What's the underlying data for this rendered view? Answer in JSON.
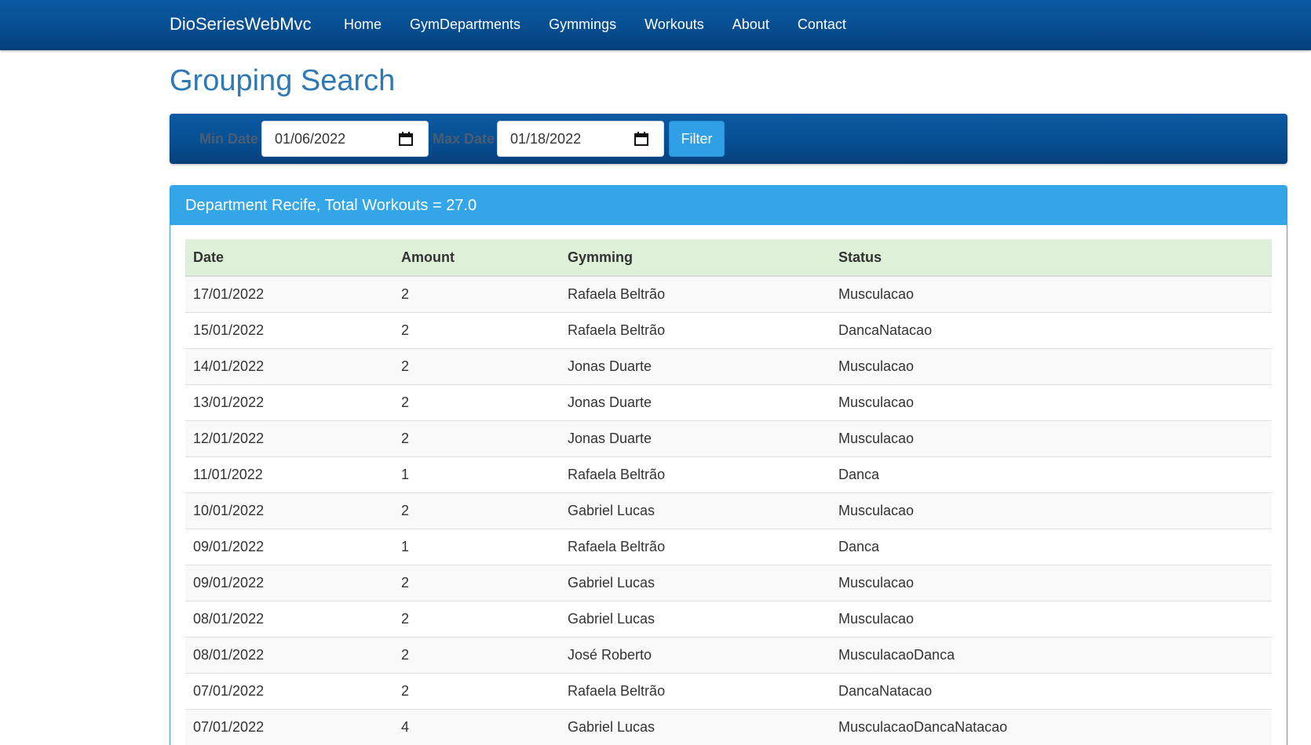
{
  "nav": {
    "brand": "DioSeriesWebMvc",
    "links": [
      "Home",
      "GymDepartments",
      "Gymmings",
      "Workouts",
      "About",
      "Contact"
    ]
  },
  "page": {
    "title": "Grouping Search"
  },
  "filter": {
    "min_label": "Min Date",
    "min_value": "01/06/2022",
    "max_label": "Max Date",
    "max_value": "01/18/2022",
    "button_label": "Filter"
  },
  "panel": {
    "heading": "Department Recife, Total Workouts = 27.0",
    "columns": [
      "Date",
      "Amount",
      "Gymming",
      "Status"
    ],
    "rows": [
      [
        "17/01/2022",
        "2",
        "Rafaela Beltrão",
        "Musculacao"
      ],
      [
        "15/01/2022",
        "2",
        "Rafaela Beltrão",
        "DancaNatacao"
      ],
      [
        "14/01/2022",
        "2",
        "Jonas Duarte",
        "Musculacao"
      ],
      [
        "13/01/2022",
        "2",
        "Jonas Duarte",
        "Musculacao"
      ],
      [
        "12/01/2022",
        "2",
        "Jonas Duarte",
        "Musculacao"
      ],
      [
        "11/01/2022",
        "1",
        "Rafaela Beltrão",
        "Danca"
      ],
      [
        "10/01/2022",
        "2",
        "Gabriel Lucas",
        "Musculacao"
      ],
      [
        "09/01/2022",
        "1",
        "Rafaela Beltrão",
        "Danca"
      ],
      [
        "09/01/2022",
        "2",
        "Gabriel Lucas",
        "Musculacao"
      ],
      [
        "08/01/2022",
        "2",
        "Gabriel Lucas",
        "Musculacao"
      ],
      [
        "08/01/2022",
        "2",
        "José Roberto",
        "MusculacaoDanca"
      ],
      [
        "07/01/2022",
        "2",
        "Rafaela Beltrão",
        "DancaNatacao"
      ],
      [
        "07/01/2022",
        "4",
        "Gabriel Lucas",
        "MusculacaoDancaNatacao"
      ]
    ]
  },
  "colors": {
    "navbar": "#074e91",
    "title": "#2e79b4",
    "panel_heading": "#34a6e8",
    "table_header": "#dff0d8",
    "filter_button": "#2f9fe6"
  },
  "icons": {
    "date_picker": "calendar-icon"
  }
}
